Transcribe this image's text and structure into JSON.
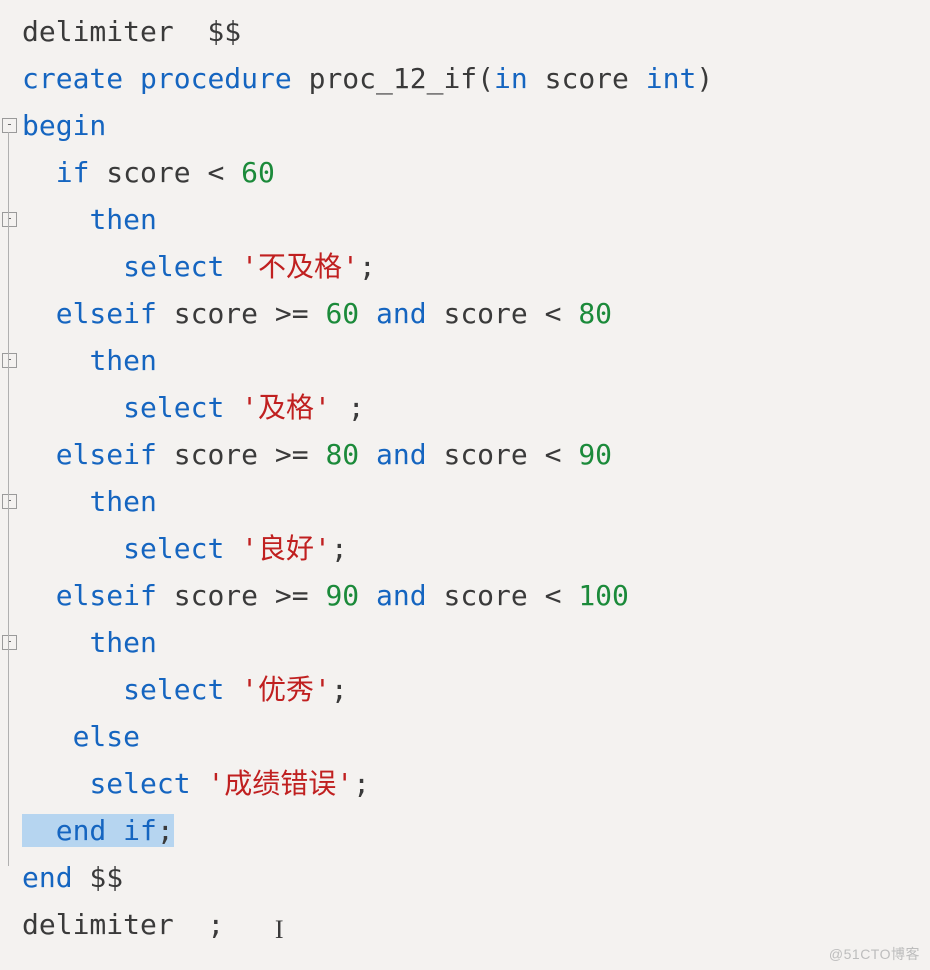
{
  "code": {
    "l1": {
      "a": "delimiter  $$"
    },
    "l2": {
      "a": "create",
      "b": " ",
      "c": "procedure",
      "d": " proc_12_if(",
      "e": "in",
      "f": " score ",
      "g": "int",
      "h": ")"
    },
    "l3": {
      "a": "begin"
    },
    "l4": {
      "a": "  ",
      "b": "if",
      "c": " score < ",
      "d": "60"
    },
    "l5": {
      "a": "    ",
      "b": "then"
    },
    "l6": {
      "a": "      ",
      "b": "select",
      "c": " ",
      "d": "'不及格'",
      "e": ";"
    },
    "l7": {
      "a": "  ",
      "b": "elseif",
      "c": " score >= ",
      "d": "60",
      "e": " ",
      "f": "and",
      "g": " score < ",
      "h": "80"
    },
    "l8": {
      "a": "    ",
      "b": "then"
    },
    "l9": {
      "a": "      ",
      "b": "select",
      "c": " ",
      "d": "'及格'",
      "e": " ;"
    },
    "l10": {
      "a": "  ",
      "b": "elseif",
      "c": " score >= ",
      "d": "80",
      "e": " ",
      "f": "and",
      "g": " score < ",
      "h": "90"
    },
    "l11": {
      "a": "    ",
      "b": "then"
    },
    "l12": {
      "a": "      ",
      "b": "select",
      "c": " ",
      "d": "'良好'",
      "e": ";"
    },
    "l13": {
      "a": "  ",
      "b": "elseif",
      "c": " score >= ",
      "d": "90",
      "e": " ",
      "f": "and",
      "g": " score < ",
      "h": "100"
    },
    "l14": {
      "a": "    ",
      "b": "then"
    },
    "l15": {
      "a": "      ",
      "b": "select",
      "c": " ",
      "d": "'优秀'",
      "e": ";"
    },
    "l16": {
      "a": "   ",
      "b": "else"
    },
    "l17": {
      "a": "    ",
      "b": "select",
      "c": " ",
      "d": "'成绩错误'",
      "e": ";"
    },
    "l18": {
      "a": "  ",
      "b": "end",
      "c": " ",
      "d": "if",
      "e": ";"
    },
    "l19": {
      "a": "end",
      "b": " $$"
    },
    "l20": {
      "a": "delimiter  ;   "
    }
  },
  "watermark": "@51CTO博客"
}
